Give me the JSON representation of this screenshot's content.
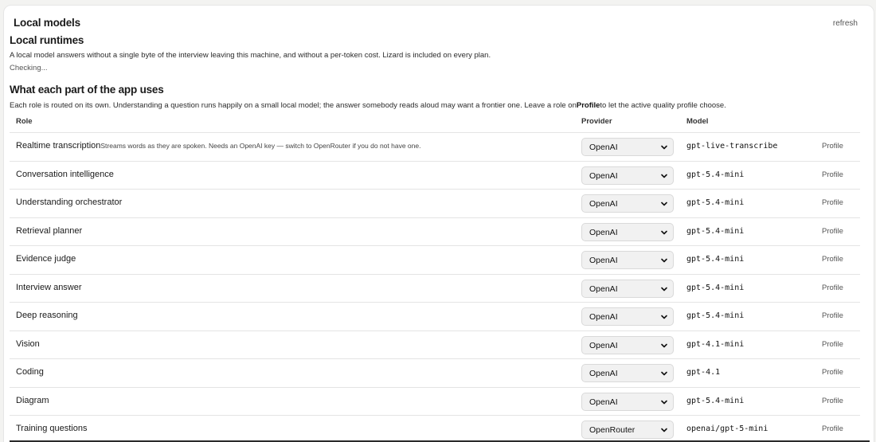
{
  "header": {
    "title": "Local models",
    "refresh_label": "refresh"
  },
  "runtimes": {
    "title": "Local runtimes",
    "description": "A local model answers without a single byte of the interview leaving this machine, and without a per-token cost. Lizard is included on every plan.",
    "status": "Checking..."
  },
  "uses": {
    "title": "What each part of the app uses",
    "description_before": "Each role is routed on its own. Understanding a question runs happily on a small local model; the answer somebody reads aloud may want a frontier one. Leave a role on",
    "description_bold": "Profile",
    "description_after": "to let the active quality profile choose."
  },
  "table": {
    "headers": {
      "role": "Role",
      "provider": "Provider",
      "model": "Model"
    },
    "rows": [
      {
        "role": "Realtime transcription",
        "note": "Streams words as they are spoken. Needs an OpenAI key — switch to OpenRouter if you do not have one.",
        "provider": "OpenAI",
        "model": "gpt-live-transcribe",
        "profile": "Profile"
      },
      {
        "role": "Conversation intelligence",
        "note": "",
        "provider": "OpenAI",
        "model": "gpt-5.4-mini",
        "profile": "Profile"
      },
      {
        "role": "Understanding orchestrator",
        "note": "",
        "provider": "OpenAI",
        "model": "gpt-5.4-mini",
        "profile": "Profile"
      },
      {
        "role": "Retrieval planner",
        "note": "",
        "provider": "OpenAI",
        "model": "gpt-5.4-mini",
        "profile": "Profile"
      },
      {
        "role": "Evidence judge",
        "note": "",
        "provider": "OpenAI",
        "model": "gpt-5.4-mini",
        "profile": "Profile"
      },
      {
        "role": "Interview answer",
        "note": "",
        "provider": "OpenAI",
        "model": "gpt-5.4-mini",
        "profile": "Profile"
      },
      {
        "role": "Deep reasoning",
        "note": "",
        "provider": "OpenAI",
        "model": "gpt-5.4-mini",
        "profile": "Profile"
      },
      {
        "role": "Vision",
        "note": "",
        "provider": "OpenAI",
        "model": "gpt-4.1-mini",
        "profile": "Profile"
      },
      {
        "role": "Coding",
        "note": "",
        "provider": "OpenAI",
        "model": "gpt-4.1",
        "profile": "Profile"
      },
      {
        "role": "Diagram",
        "note": "",
        "provider": "OpenAI",
        "model": "gpt-5.4-mini",
        "profile": "Profile"
      },
      {
        "role": "Training questions",
        "note": "",
        "provider": "OpenRouter",
        "model": "openai/gpt-5-mini",
        "profile": "Profile"
      }
    ]
  },
  "icons": {
    "select_chevron": "chevron-down-icon"
  }
}
